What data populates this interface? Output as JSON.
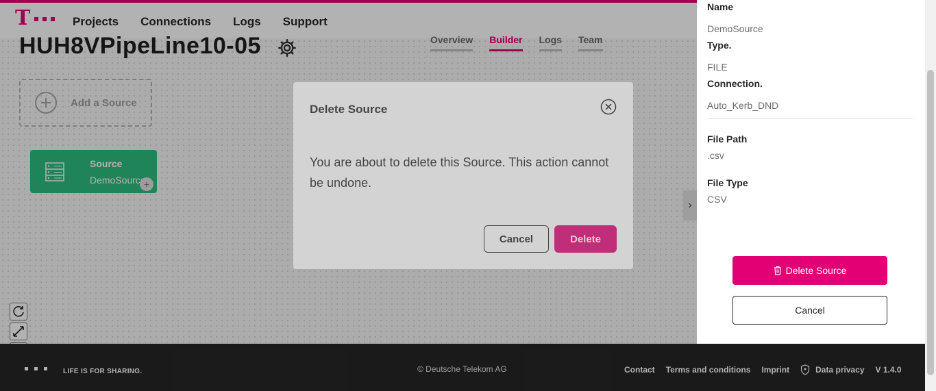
{
  "header": {
    "logo_letter": "T",
    "nav": [
      "Projects",
      "Connections",
      "Logs",
      "Support"
    ]
  },
  "pipeline": {
    "title": "HUH8VPipeLine10-05",
    "tabs": [
      {
        "label": "Overview",
        "active": false
      },
      {
        "label": "Builder",
        "active": true
      },
      {
        "label": "Logs",
        "active": false
      },
      {
        "label": "Team",
        "active": false
      }
    ],
    "add_source_label": "Add a Source",
    "source_node": {
      "title": "Source",
      "subtitle": "DemoSource",
      "add": "+"
    }
  },
  "right_panel": {
    "name_label": "Name",
    "name_value": "DemoSource",
    "type_label": "Type.",
    "type_value": "FILE",
    "connection_label": "Connection.",
    "connection_value": "Auto_Kerb_DND",
    "file_path_label": "File Path",
    "file_path_value": ".csv",
    "file_type_label": "File Type",
    "file_type_value": "CSV",
    "delete_button": "Delete Source",
    "cancel_button": "Cancel"
  },
  "modal": {
    "title": "Delete Source",
    "body": "You are about to delete this Source. This action cannot be undone.",
    "cancel": "Cancel",
    "delete": "Delete"
  },
  "footer": {
    "tagline": "LIFE IS FOR SHARING.",
    "copyright": "© Deutsche Telekom AG",
    "links": [
      "Contact",
      "Terms and conditions",
      "Imprint",
      "Data privacy"
    ],
    "version": "V 1.4.0"
  },
  "colors": {
    "brand": "#e20074",
    "source_node": "#2fbd80",
    "footer_bg": "#262626"
  },
  "icons": [
    "gear-icon",
    "plus-circle-icon",
    "server-icon",
    "chevron-right-icon",
    "refresh-icon",
    "fit-view-icon",
    "zoom-in-icon",
    "zoom-out-icon",
    "close-circle-icon",
    "trash-icon",
    "shield-icon"
  ]
}
